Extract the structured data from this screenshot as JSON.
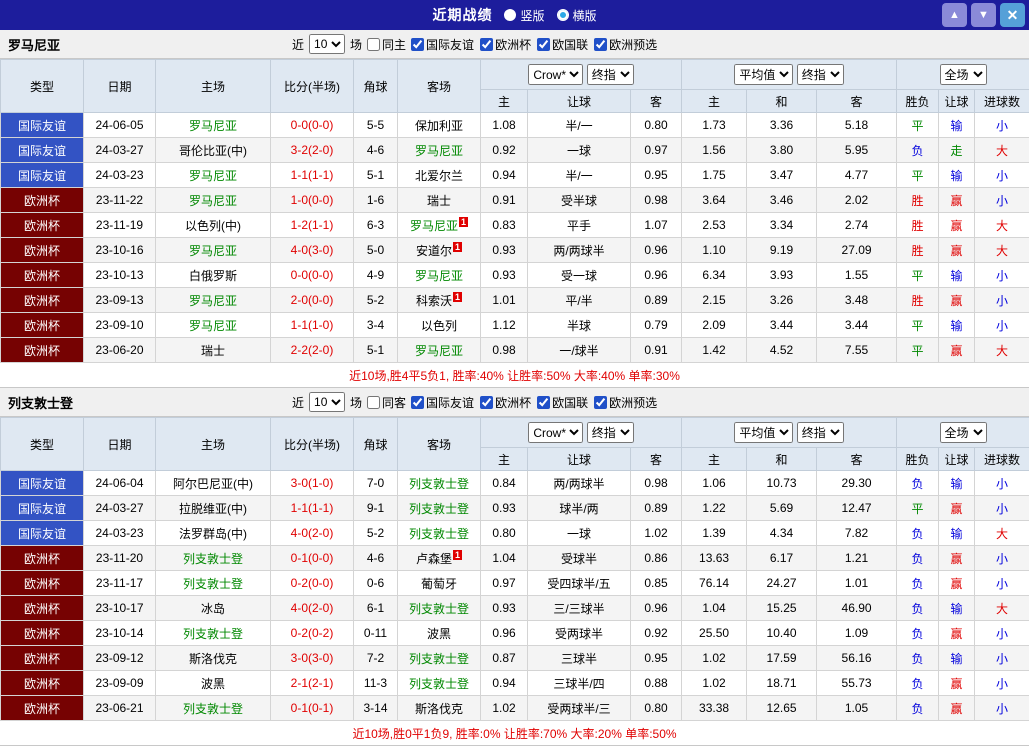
{
  "topbar": {
    "title": "近期战绩",
    "layout_options": [
      {
        "label": "竖版",
        "selected": false
      },
      {
        "label": "横版",
        "selected": true
      }
    ],
    "up_icon": "▲",
    "down_icon": "▼",
    "close_icon": "✕"
  },
  "colors": {
    "navy": "#1d1d9c",
    "type_bg": {
      "国际友谊": "#3353c4",
      "欧洲杯": "#760202"
    },
    "result": {
      "胜": "#e00000",
      "平": "#008800",
      "负": "#0000dd",
      "赢": "#e00000",
      "输": "#0000dd",
      "走": "#008800",
      "大": "#e00000",
      "小": "#0000dd"
    },
    "team_highlight": "#008800",
    "score_color": "#e00000"
  },
  "table_header": {
    "type": "类型",
    "date": "日期",
    "home": "主场",
    "score": "比分(半场)",
    "corner": "角球",
    "away": "客场",
    "crow_select": "Crow*",
    "final_select": "终指",
    "avg_select": "平均值",
    "final_select2": "终指",
    "full_select": "全场",
    "crow_cols": [
      "主",
      "让球",
      "客"
    ],
    "avg_cols": [
      "主",
      "和",
      "客"
    ],
    "full_cols": [
      "胜负",
      "让球",
      "进球数"
    ]
  },
  "sections": [
    {
      "team": "罗马尼亚",
      "filter": {
        "near": "近",
        "count": "10",
        "games": "场",
        "same": "同主",
        "same_checked": false,
        "comps": [
          {
            "label": "国际友谊",
            "checked": true
          },
          {
            "label": "欧洲杯",
            "checked": true
          },
          {
            "label": "欧国联",
            "checked": true
          },
          {
            "label": "欧洲预选",
            "checked": true
          }
        ]
      },
      "rows": [
        {
          "type": "国际友谊",
          "date": "24-06-05",
          "home": "罗马尼亚",
          "home_hl": true,
          "away": "保加利亚",
          "score": "0-0(0-0)",
          "corner": "5-5",
          "odds": [
            "1.08",
            "半/一",
            "0.80"
          ],
          "avg": [
            "1.73",
            "3.36",
            "5.18"
          ],
          "res": [
            "平",
            "输",
            "小"
          ]
        },
        {
          "type": "国际友谊",
          "date": "24-03-27",
          "home": "哥伦比亚(中)",
          "away": "罗马尼亚",
          "away_hl": true,
          "score": "3-2(2-0)",
          "corner": "4-6",
          "odds": [
            "0.92",
            "一球",
            "0.97"
          ],
          "avg": [
            "1.56",
            "3.80",
            "5.95"
          ],
          "res": [
            "负",
            "走",
            "大"
          ]
        },
        {
          "type": "国际友谊",
          "date": "24-03-23",
          "home": "罗马尼亚",
          "home_hl": true,
          "away": "北爱尔兰",
          "score": "1-1(1-1)",
          "corner": "5-1",
          "odds": [
            "0.94",
            "半/一",
            "0.95"
          ],
          "avg": [
            "1.75",
            "3.47",
            "4.77"
          ],
          "res": [
            "平",
            "输",
            "小"
          ]
        },
        {
          "type": "欧洲杯",
          "date": "23-11-22",
          "home": "罗马尼亚",
          "home_hl": true,
          "away": "瑞士",
          "score": "1-0(0-0)",
          "corner": "1-6",
          "odds": [
            "0.91",
            "受半球",
            "0.98"
          ],
          "avg": [
            "3.64",
            "3.46",
            "2.02"
          ],
          "res": [
            "胜",
            "赢",
            "小"
          ]
        },
        {
          "type": "欧洲杯",
          "date": "23-11-19",
          "home": "以色列(中)",
          "away": "罗马尼亚",
          "away_hl": true,
          "away_badge": "1",
          "score": "1-2(1-1)",
          "corner": "6-3",
          "odds": [
            "0.83",
            "平手",
            "1.07"
          ],
          "avg": [
            "2.53",
            "3.34",
            "2.74"
          ],
          "res": [
            "胜",
            "赢",
            "大"
          ]
        },
        {
          "type": "欧洲杯",
          "date": "23-10-16",
          "home": "罗马尼亚",
          "home_hl": true,
          "away": "安道尔",
          "away_badge": "1",
          "score": "4-0(3-0)",
          "corner": "5-0",
          "odds": [
            "0.93",
            "两/两球半",
            "0.96"
          ],
          "avg": [
            "1.10",
            "9.19",
            "27.09"
          ],
          "res": [
            "胜",
            "赢",
            "大"
          ]
        },
        {
          "type": "欧洲杯",
          "date": "23-10-13",
          "home": "白俄罗斯",
          "away": "罗马尼亚",
          "away_hl": true,
          "score": "0-0(0-0)",
          "corner": "4-9",
          "odds": [
            "0.93",
            "受一球",
            "0.96"
          ],
          "avg": [
            "6.34",
            "3.93",
            "1.55"
          ],
          "res": [
            "平",
            "输",
            "小"
          ]
        },
        {
          "type": "欧洲杯",
          "date": "23-09-13",
          "home": "罗马尼亚",
          "home_hl": true,
          "away": "科索沃",
          "away_badge": "1",
          "score": "2-0(0-0)",
          "corner": "5-2",
          "odds": [
            "1.01",
            "平/半",
            "0.89"
          ],
          "avg": [
            "2.15",
            "3.26",
            "3.48"
          ],
          "res": [
            "胜",
            "赢",
            "小"
          ]
        },
        {
          "type": "欧洲杯",
          "date": "23-09-10",
          "home": "罗马尼亚",
          "home_hl": true,
          "away": "以色列",
          "score": "1-1(1-0)",
          "corner": "3-4",
          "odds": [
            "1.12",
            "半球",
            "0.79"
          ],
          "avg": [
            "2.09",
            "3.44",
            "3.44"
          ],
          "res": [
            "平",
            "输",
            "小"
          ]
        },
        {
          "type": "欧洲杯",
          "date": "23-06-20",
          "home": "瑞士",
          "away": "罗马尼亚",
          "away_hl": true,
          "score": "2-2(2-0)",
          "corner": "5-1",
          "odds": [
            "0.98",
            "一/球半",
            "0.91"
          ],
          "avg": [
            "1.42",
            "4.52",
            "7.55"
          ],
          "res": [
            "平",
            "赢",
            "大"
          ]
        }
      ],
      "footer": "近10场,胜4平5负1, 胜率:40% 让胜率:50% 大率:40% 单率:30%"
    },
    {
      "team": "列支敦士登",
      "filter": {
        "near": "近",
        "count": "10",
        "games": "场",
        "same": "同客",
        "same_checked": false,
        "comps": [
          {
            "label": "国际友谊",
            "checked": true
          },
          {
            "label": "欧洲杯",
            "checked": true
          },
          {
            "label": "欧国联",
            "checked": true
          },
          {
            "label": "欧洲预选",
            "checked": true
          }
        ]
      },
      "rows": [
        {
          "type": "国际友谊",
          "date": "24-06-04",
          "home": "阿尔巴尼亚(中)",
          "away": "列支敦士登",
          "away_hl": true,
          "score": "3-0(1-0)",
          "corner": "7-0",
          "odds": [
            "0.84",
            "两/两球半",
            "0.98"
          ],
          "avg": [
            "1.06",
            "10.73",
            "29.30"
          ],
          "res": [
            "负",
            "输",
            "小"
          ]
        },
        {
          "type": "国际友谊",
          "date": "24-03-27",
          "home": "拉脱维亚(中)",
          "away": "列支敦士登",
          "away_hl": true,
          "score": "1-1(1-1)",
          "corner": "9-1",
          "odds": [
            "0.93",
            "球半/两",
            "0.89"
          ],
          "avg": [
            "1.22",
            "5.69",
            "12.47"
          ],
          "res": [
            "平",
            "赢",
            "小"
          ]
        },
        {
          "type": "国际友谊",
          "date": "24-03-23",
          "home": "法罗群岛(中)",
          "away": "列支敦士登",
          "away_hl": true,
          "score": "4-0(2-0)",
          "corner": "5-2",
          "odds": [
            "0.80",
            "一球",
            "1.02"
          ],
          "avg": [
            "1.39",
            "4.34",
            "7.82"
          ],
          "res": [
            "负",
            "输",
            "大"
          ]
        },
        {
          "type": "欧洲杯",
          "date": "23-11-20",
          "home": "列支敦士登",
          "home_hl": true,
          "away": "卢森堡",
          "away_badge": "1",
          "score": "0-1(0-0)",
          "corner": "4-6",
          "odds": [
            "1.04",
            "受球半",
            "0.86"
          ],
          "avg": [
            "13.63",
            "6.17",
            "1.21"
          ],
          "res": [
            "负",
            "赢",
            "小"
          ]
        },
        {
          "type": "欧洲杯",
          "date": "23-11-17",
          "home": "列支敦士登",
          "home_hl": true,
          "away": "葡萄牙",
          "score": "0-2(0-0)",
          "corner": "0-6",
          "odds": [
            "0.97",
            "受四球半/五",
            "0.85"
          ],
          "avg": [
            "76.14",
            "24.27",
            "1.01"
          ],
          "res": [
            "负",
            "赢",
            "小"
          ]
        },
        {
          "type": "欧洲杯",
          "date": "23-10-17",
          "home": "冰岛",
          "away": "列支敦士登",
          "away_hl": true,
          "score": "4-0(2-0)",
          "corner": "6-1",
          "odds": [
            "0.93",
            "三/三球半",
            "0.96"
          ],
          "avg": [
            "1.04",
            "15.25",
            "46.90"
          ],
          "res": [
            "负",
            "输",
            "大"
          ]
        },
        {
          "type": "欧洲杯",
          "date": "23-10-14",
          "home": "列支敦士登",
          "home_hl": true,
          "away": "波黑",
          "score": "0-2(0-2)",
          "corner": "0-11",
          "odds": [
            "0.96",
            "受两球半",
            "0.92"
          ],
          "avg": [
            "25.50",
            "10.40",
            "1.09"
          ],
          "res": [
            "负",
            "赢",
            "小"
          ]
        },
        {
          "type": "欧洲杯",
          "date": "23-09-12",
          "home": "斯洛伐克",
          "away": "列支敦士登",
          "away_hl": true,
          "score": "3-0(3-0)",
          "corner": "7-2",
          "odds": [
            "0.87",
            "三球半",
            "0.95"
          ],
          "avg": [
            "1.02",
            "17.59",
            "56.16"
          ],
          "res": [
            "负",
            "输",
            "小"
          ]
        },
        {
          "type": "欧洲杯",
          "date": "23-09-09",
          "home": "波黑",
          "away": "列支敦士登",
          "away_hl": true,
          "score": "2-1(2-1)",
          "corner": "11-3",
          "odds": [
            "0.94",
            "三球半/四",
            "0.88"
          ],
          "avg": [
            "1.02",
            "18.71",
            "55.73"
          ],
          "res": [
            "负",
            "赢",
            "小"
          ]
        },
        {
          "type": "欧洲杯",
          "date": "23-06-21",
          "home": "列支敦士登",
          "home_hl": true,
          "away": "斯洛伐克",
          "score": "0-1(0-1)",
          "corner": "3-14",
          "odds": [
            "1.02",
            "受两球半/三",
            "0.80"
          ],
          "avg": [
            "33.38",
            "12.65",
            "1.05"
          ],
          "res": [
            "负",
            "赢",
            "小"
          ]
        }
      ],
      "footer": "近10场,胜0平1负9, 胜率:0% 让胜率:70% 大率:20% 单率:50%"
    }
  ]
}
